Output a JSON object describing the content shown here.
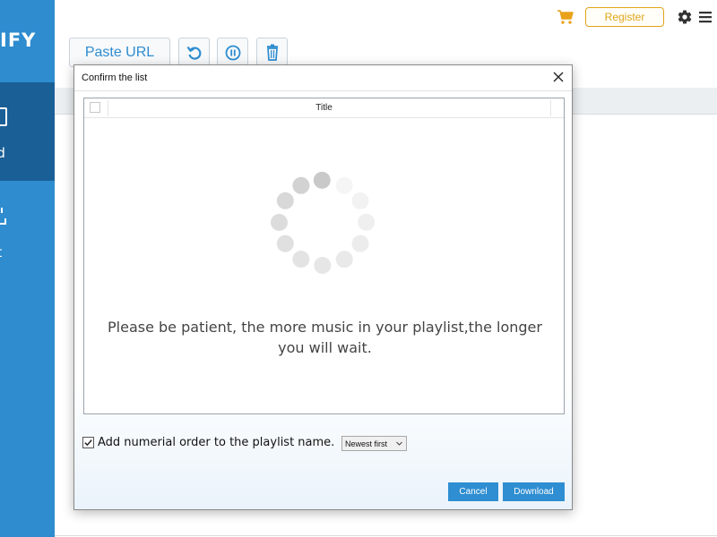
{
  "app": {
    "brand": "IFY"
  },
  "sidebar": {
    "items": [
      {
        "label": "oad",
        "icon": "download-icon",
        "active": true
      },
      {
        "label": "ert",
        "icon": "convert-icon",
        "active": false
      }
    ]
  },
  "topbar": {
    "register_label": "Register",
    "accent_color": "#e0a41a",
    "icons": [
      "cart-icon",
      "gear-icon",
      "menu-icon"
    ]
  },
  "toolbar": {
    "paste_url_label": "Paste URL",
    "icons": [
      "retry-icon",
      "pause-icon",
      "trash-icon"
    ]
  },
  "dialog": {
    "title": "Confirm the list",
    "list_header_title": "Title",
    "wait_message": "Please be patient, the more music in your playlist,the longer you will wait.",
    "order_label": "Add numerial order to the playlist name.",
    "order_checked": true,
    "sort_selected": "Newest first",
    "cancel_label": "Cancel",
    "download_label": "Download",
    "button_color": "#2f8ed2"
  },
  "colors": {
    "sidebar": "#2e8ccf",
    "sidebar_active": "#1b5f97"
  }
}
